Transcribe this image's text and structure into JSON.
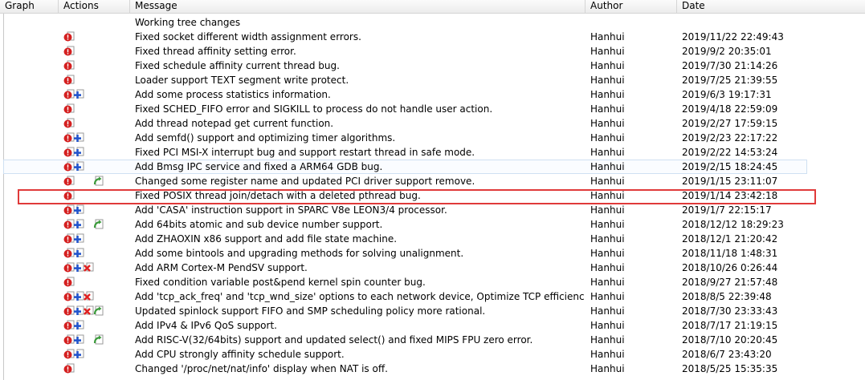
{
  "columns": {
    "graph": "Graph",
    "actions": "Actions",
    "message": "Message",
    "author": "Author",
    "date": "Date"
  },
  "colors": {
    "selection_border": "#e03a3a",
    "hover_border": "#cfe0f2",
    "modified_icon": "#d42020",
    "added_icon": "#2255cc",
    "deleted_icon": "#e02020",
    "renamed_icon": "#3a9a3a"
  },
  "rows": [
    {
      "actions": [],
      "message": "Working tree changes",
      "author": "",
      "date": ""
    },
    {
      "actions": [
        "modified"
      ],
      "message": "Fixed socket different width assignment errors.",
      "author": "Hanhui",
      "date": "2019/11/22 22:49:43"
    },
    {
      "actions": [
        "modified"
      ],
      "message": "Fixed thread affinity setting error.",
      "author": "Hanhui",
      "date": "2019/9/2 20:35:01"
    },
    {
      "actions": [
        "modified"
      ],
      "message": "Fixed schedule affinity current thread bug.",
      "author": "Hanhui",
      "date": "2019/7/30 21:14:26"
    },
    {
      "actions": [
        "modified"
      ],
      "message": "Loader support TEXT segment write protect.",
      "author": "Hanhui",
      "date": "2019/7/25 21:39:55"
    },
    {
      "actions": [
        "modified",
        "added"
      ],
      "message": "Add some process statistics information.",
      "author": "Hanhui",
      "date": "2019/6/3 19:17:31"
    },
    {
      "actions": [
        "modified"
      ],
      "message": "Fixed SCHED_FIFO error and SIGKILL to process do not handle user action.",
      "author": "Hanhui",
      "date": "2019/4/18 22:59:09"
    },
    {
      "actions": [
        "modified"
      ],
      "message": "Add thread notepad get current function.",
      "author": "Hanhui",
      "date": "2019/2/27 17:59:15"
    },
    {
      "actions": [
        "modified",
        "added"
      ],
      "message": "Add semfd() support and optimizing timer algorithms.",
      "author": "Hanhui",
      "date": "2019/2/23 22:17:22"
    },
    {
      "actions": [
        "modified",
        "added"
      ],
      "message": "Fixed PCI MSI-X interrupt bug and support restart thread in safe mode.",
      "author": "Hanhui",
      "date": "2019/2/22 14:53:24"
    },
    {
      "actions": [
        "modified",
        "added"
      ],
      "message": "Add Bmsg IPC service and fixed a ARM64 GDB bug.",
      "author": "Hanhui",
      "date": "2019/2/15 18:24:45",
      "hover": true
    },
    {
      "actions": [
        "modified",
        "",
        "",
        "renamed"
      ],
      "message": "Changed some register name and updated PCI driver support remove.",
      "author": "Hanhui",
      "date": "2019/1/15 23:11:07"
    },
    {
      "actions": [
        "modified"
      ],
      "message": "Fixed POSIX thread join/detach with a deleted pthread bug.",
      "author": "Hanhui",
      "date": "2019/1/14 23:42:18",
      "selected": true
    },
    {
      "actions": [
        "modified",
        "added"
      ],
      "message": "Add 'CASA' instruction support in SPARC V8e LEON3/4 processor.",
      "author": "Hanhui",
      "date": "2019/1/7 22:15:17"
    },
    {
      "actions": [
        "modified",
        "added",
        "",
        "renamed"
      ],
      "message": "Add 64bits atomic and sub device number support.",
      "author": "Hanhui",
      "date": "2018/12/12 18:29:23"
    },
    {
      "actions": [
        "modified",
        "added"
      ],
      "message": "Add ZHAOXIN x86 support and add file state machine.",
      "author": "Hanhui",
      "date": "2018/12/1 21:20:42"
    },
    {
      "actions": [
        "modified",
        "added"
      ],
      "message": "Add some bintools and upgrading methods for solving unalignment.",
      "author": "Hanhui",
      "date": "2018/11/18 1:48:31"
    },
    {
      "actions": [
        "modified",
        "added",
        "deleted"
      ],
      "message": "Add ARM Cortex-M PendSV support.",
      "author": "Hanhui",
      "date": "2018/10/26 0:26:44"
    },
    {
      "actions": [
        "modified"
      ],
      "message": "Fixed condition variable post&pend kernel spin counter bug.",
      "author": "Hanhui",
      "date": "2018/9/27 21:57:48"
    },
    {
      "actions": [
        "modified",
        "added",
        "deleted"
      ],
      "message": "Add 'tcp_ack_freq' and 'tcp_wnd_size' options to each network device, Optimize TCP efficiency.",
      "author": "Hanhui",
      "date": "2018/8/5 22:39:48"
    },
    {
      "actions": [
        "modified",
        "added",
        "deleted",
        "renamed"
      ],
      "message": "Updated spinlock support FIFO and SMP scheduling policy more rational.",
      "author": "Hanhui",
      "date": "2018/7/30 23:33:43"
    },
    {
      "actions": [
        "modified",
        "added"
      ],
      "message": "Add IPv4 & IPv6 QoS support.",
      "author": "Hanhui",
      "date": "2018/7/17 21:19:15"
    },
    {
      "actions": [
        "modified",
        "added",
        "",
        "renamed"
      ],
      "message": "Add RISC-V(32/64bits) support and updated select() and fixed MIPS FPU zero error.",
      "author": "Hanhui",
      "date": "2018/7/10 20:20:45"
    },
    {
      "actions": [
        "modified",
        "added"
      ],
      "message": "Add CPU strongly affinity schedule support.",
      "author": "Hanhui",
      "date": "2018/6/7 23:43:20"
    },
    {
      "actions": [
        "modified"
      ],
      "message": "Changed '/proc/net/nat/info' display when NAT is off.",
      "author": "Hanhui",
      "date": "2018/5/25 15:35:35"
    }
  ]
}
